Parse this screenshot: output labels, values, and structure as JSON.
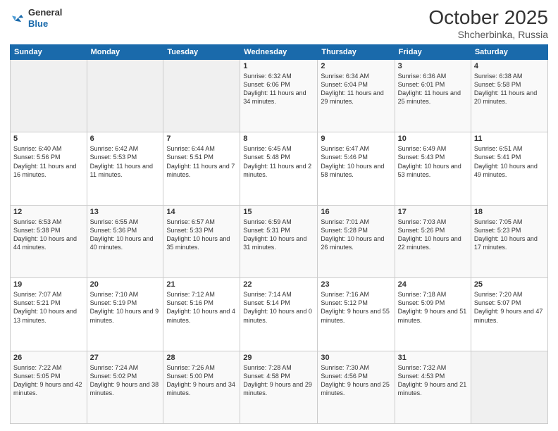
{
  "header": {
    "logo_general": "General",
    "logo_blue": "Blue",
    "month": "October 2025",
    "location": "Shcherbinka, Russia"
  },
  "weekdays": [
    "Sunday",
    "Monday",
    "Tuesday",
    "Wednesday",
    "Thursday",
    "Friday",
    "Saturday"
  ],
  "weeks": [
    [
      {
        "day": "",
        "content": ""
      },
      {
        "day": "",
        "content": ""
      },
      {
        "day": "",
        "content": ""
      },
      {
        "day": "1",
        "content": "Sunrise: 6:32 AM\nSunset: 6:06 PM\nDaylight: 11 hours\nand 34 minutes."
      },
      {
        "day": "2",
        "content": "Sunrise: 6:34 AM\nSunset: 6:04 PM\nDaylight: 11 hours\nand 29 minutes."
      },
      {
        "day": "3",
        "content": "Sunrise: 6:36 AM\nSunset: 6:01 PM\nDaylight: 11 hours\nand 25 minutes."
      },
      {
        "day": "4",
        "content": "Sunrise: 6:38 AM\nSunset: 5:58 PM\nDaylight: 11 hours\nand 20 minutes."
      }
    ],
    [
      {
        "day": "5",
        "content": "Sunrise: 6:40 AM\nSunset: 5:56 PM\nDaylight: 11 hours\nand 16 minutes."
      },
      {
        "day": "6",
        "content": "Sunrise: 6:42 AM\nSunset: 5:53 PM\nDaylight: 11 hours\nand 11 minutes."
      },
      {
        "day": "7",
        "content": "Sunrise: 6:44 AM\nSunset: 5:51 PM\nDaylight: 11 hours\nand 7 minutes."
      },
      {
        "day": "8",
        "content": "Sunrise: 6:45 AM\nSunset: 5:48 PM\nDaylight: 11 hours\nand 2 minutes."
      },
      {
        "day": "9",
        "content": "Sunrise: 6:47 AM\nSunset: 5:46 PM\nDaylight: 10 hours\nand 58 minutes."
      },
      {
        "day": "10",
        "content": "Sunrise: 6:49 AM\nSunset: 5:43 PM\nDaylight: 10 hours\nand 53 minutes."
      },
      {
        "day": "11",
        "content": "Sunrise: 6:51 AM\nSunset: 5:41 PM\nDaylight: 10 hours\nand 49 minutes."
      }
    ],
    [
      {
        "day": "12",
        "content": "Sunrise: 6:53 AM\nSunset: 5:38 PM\nDaylight: 10 hours\nand 44 minutes."
      },
      {
        "day": "13",
        "content": "Sunrise: 6:55 AM\nSunset: 5:36 PM\nDaylight: 10 hours\nand 40 minutes."
      },
      {
        "day": "14",
        "content": "Sunrise: 6:57 AM\nSunset: 5:33 PM\nDaylight: 10 hours\nand 35 minutes."
      },
      {
        "day": "15",
        "content": "Sunrise: 6:59 AM\nSunset: 5:31 PM\nDaylight: 10 hours\nand 31 minutes."
      },
      {
        "day": "16",
        "content": "Sunrise: 7:01 AM\nSunset: 5:28 PM\nDaylight: 10 hours\nand 26 minutes."
      },
      {
        "day": "17",
        "content": "Sunrise: 7:03 AM\nSunset: 5:26 PM\nDaylight: 10 hours\nand 22 minutes."
      },
      {
        "day": "18",
        "content": "Sunrise: 7:05 AM\nSunset: 5:23 PM\nDaylight: 10 hours\nand 17 minutes."
      }
    ],
    [
      {
        "day": "19",
        "content": "Sunrise: 7:07 AM\nSunset: 5:21 PM\nDaylight: 10 hours\nand 13 minutes."
      },
      {
        "day": "20",
        "content": "Sunrise: 7:10 AM\nSunset: 5:19 PM\nDaylight: 10 hours\nand 9 minutes."
      },
      {
        "day": "21",
        "content": "Sunrise: 7:12 AM\nSunset: 5:16 PM\nDaylight: 10 hours\nand 4 minutes."
      },
      {
        "day": "22",
        "content": "Sunrise: 7:14 AM\nSunset: 5:14 PM\nDaylight: 10 hours\nand 0 minutes."
      },
      {
        "day": "23",
        "content": "Sunrise: 7:16 AM\nSunset: 5:12 PM\nDaylight: 9 hours\nand 55 minutes."
      },
      {
        "day": "24",
        "content": "Sunrise: 7:18 AM\nSunset: 5:09 PM\nDaylight: 9 hours\nand 51 minutes."
      },
      {
        "day": "25",
        "content": "Sunrise: 7:20 AM\nSunset: 5:07 PM\nDaylight: 9 hours\nand 47 minutes."
      }
    ],
    [
      {
        "day": "26",
        "content": "Sunrise: 7:22 AM\nSunset: 5:05 PM\nDaylight: 9 hours\nand 42 minutes."
      },
      {
        "day": "27",
        "content": "Sunrise: 7:24 AM\nSunset: 5:02 PM\nDaylight: 9 hours\nand 38 minutes."
      },
      {
        "day": "28",
        "content": "Sunrise: 7:26 AM\nSunset: 5:00 PM\nDaylight: 9 hours\nand 34 minutes."
      },
      {
        "day": "29",
        "content": "Sunrise: 7:28 AM\nSunset: 4:58 PM\nDaylight: 9 hours\nand 29 minutes."
      },
      {
        "day": "30",
        "content": "Sunrise: 7:30 AM\nSunset: 4:56 PM\nDaylight: 9 hours\nand 25 minutes."
      },
      {
        "day": "31",
        "content": "Sunrise: 7:32 AM\nSunset: 4:53 PM\nDaylight: 9 hours\nand 21 minutes."
      },
      {
        "day": "",
        "content": ""
      }
    ]
  ]
}
